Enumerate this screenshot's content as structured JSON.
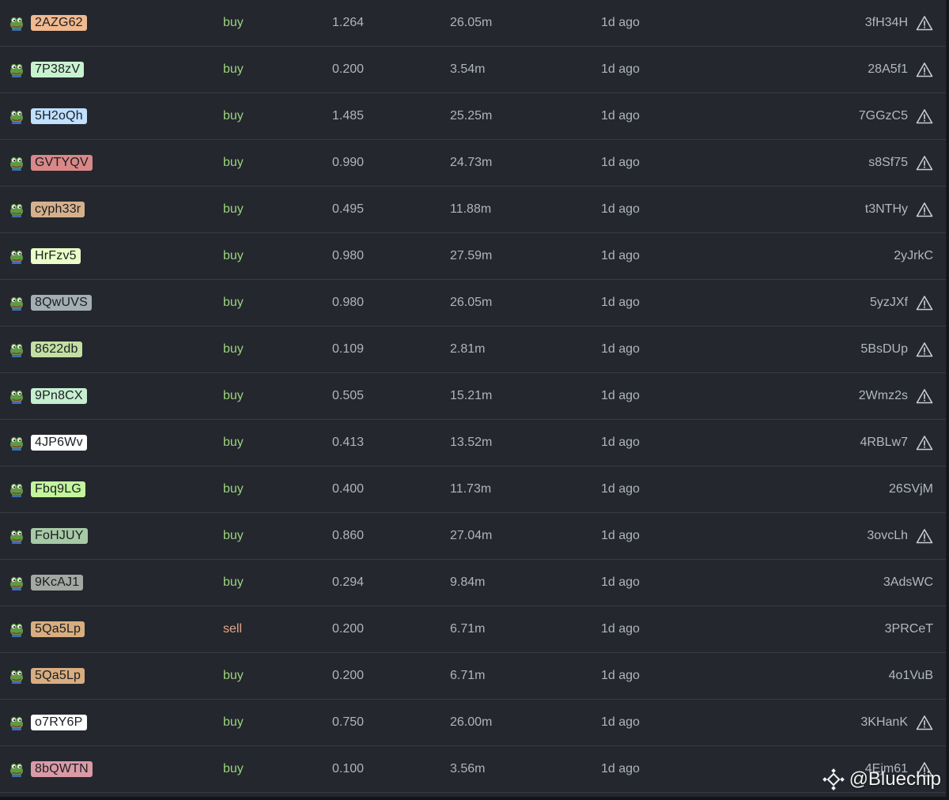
{
  "colors": {
    "background": "#24272e",
    "row_divider": "#373b44",
    "buy": "#9ad27c",
    "sell": "#e6a587"
  },
  "rows": [
    {
      "token": "2AZG62",
      "badge_color": "#f0b98f",
      "side": "buy",
      "amount": "1.264",
      "mcap": "26.05m",
      "time": "1d ago",
      "trader": "3fH34H",
      "warning": true,
      "icon": "pepe-frog-icon"
    },
    {
      "token": "7P38zV",
      "badge_color": "#c8f2cf",
      "side": "buy",
      "amount": "0.200",
      "mcap": "3.54m",
      "time": "1d ago",
      "trader": "28A5f1",
      "warning": true,
      "icon": "pepe-frog-icon"
    },
    {
      "token": "5H2oQh",
      "badge_color": "#bfe0ff",
      "side": "buy",
      "amount": "1.485",
      "mcap": "25.25m",
      "time": "1d ago",
      "trader": "7GGzC5",
      "warning": true,
      "icon": "pepe-frog-icon"
    },
    {
      "token": "GVTYQV",
      "badge_color": "#d98888",
      "side": "buy",
      "amount": "0.990",
      "mcap": "24.73m",
      "time": "1d ago",
      "trader": "s8Sf75",
      "warning": true,
      "icon": "pepe-frog-icon"
    },
    {
      "token": "cyph33r",
      "badge_color": "#d6b08d",
      "side": "buy",
      "amount": "0.495",
      "mcap": "11.88m",
      "time": "1d ago",
      "trader": "t3NTHy",
      "warning": true,
      "icon": "pepe-frog-icon"
    },
    {
      "token": "HrFzv5",
      "badge_color": "#eaffc8",
      "side": "buy",
      "amount": "0.980",
      "mcap": "27.59m",
      "time": "1d ago",
      "trader": "2yJrkC",
      "warning": false,
      "icon": "pepe-frog-icon"
    },
    {
      "token": "8QwUVS",
      "badge_color": "#a4aeb5",
      "side": "buy",
      "amount": "0.980",
      "mcap": "26.05m",
      "time": "1d ago",
      "trader": "5yzJXf",
      "warning": true,
      "icon": "pepe-frog-icon"
    },
    {
      "token": "8622db",
      "badge_color": "#c3dfa2",
      "side": "buy",
      "amount": "0.109",
      "mcap": "2.81m",
      "time": "1d ago",
      "trader": "5BsDUp",
      "warning": true,
      "icon": "pepe-frog-icon"
    },
    {
      "token": "9Pn8CX",
      "badge_color": "#c5efd0",
      "side": "buy",
      "amount": "0.505",
      "mcap": "15.21m",
      "time": "1d ago",
      "trader": "2Wmz2s",
      "warning": true,
      "icon": "pepe-frog-icon"
    },
    {
      "token": "4JP6Wv",
      "badge_color": "#ffffff",
      "side": "buy",
      "amount": "0.413",
      "mcap": "13.52m",
      "time": "1d ago",
      "trader": "4RBLw7",
      "warning": true,
      "icon": "pepe-frog-icon"
    },
    {
      "token": "Fbq9LG",
      "badge_color": "#c2f59c",
      "side": "buy",
      "amount": "0.400",
      "mcap": "11.73m",
      "time": "1d ago",
      "trader": "26SVjM",
      "warning": false,
      "icon": "pepe-frog-icon"
    },
    {
      "token": "FoHJUY",
      "badge_color": "#a7c9a6",
      "side": "buy",
      "amount": "0.860",
      "mcap": "27.04m",
      "time": "1d ago",
      "trader": "3ovcLh",
      "warning": true,
      "icon": "pepe-frog-icon"
    },
    {
      "token": "9KcAJ1",
      "badge_color": "#a3a8a2",
      "side": "buy",
      "amount": "0.294",
      "mcap": "9.84m",
      "time": "1d ago",
      "trader": "3AdsWC",
      "warning": false,
      "icon": "pepe-frog-icon"
    },
    {
      "token": "5Qa5Lp",
      "badge_color": "#d8ad80",
      "side": "sell",
      "amount": "0.200",
      "mcap": "6.71m",
      "time": "1d ago",
      "trader": "3PRCeT",
      "warning": false,
      "icon": "pepe-frog-icon"
    },
    {
      "token": "5Qa5Lp",
      "badge_color": "#d8ad80",
      "side": "buy",
      "amount": "0.200",
      "mcap": "6.71m",
      "time": "1d ago",
      "trader": "4o1VuB",
      "warning": false,
      "icon": "pepe-frog-icon"
    },
    {
      "token": "o7RY6P",
      "badge_color": "#ffffff",
      "side": "buy",
      "amount": "0.750",
      "mcap": "26.00m",
      "time": "1d ago",
      "trader": "3KHanK",
      "warning": true,
      "icon": "pepe-frog-icon"
    },
    {
      "token": "8bQWTN",
      "badge_color": "#d99aa6",
      "side": "buy",
      "amount": "0.100",
      "mcap": "3.56m",
      "time": "1d ago",
      "trader": "4Ejm61",
      "warning": true,
      "icon": "pepe-frog-icon"
    }
  ],
  "watermark": {
    "text": "@Bluechip",
    "icon": "binance-square-logo-icon"
  }
}
